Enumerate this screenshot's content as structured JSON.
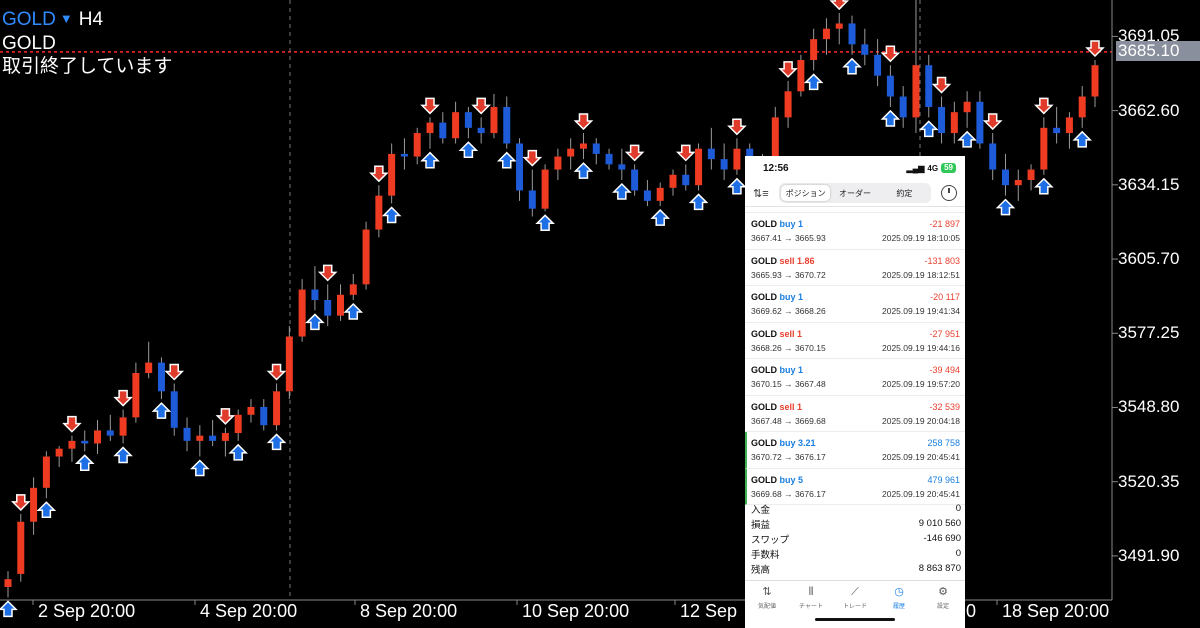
{
  "header": {
    "symbol": "GOLD",
    "caret": "▼",
    "timeframe": "H4",
    "symbol_name": "GOLD",
    "status": "取引終了しています"
  },
  "price_axis": {
    "labels": [
      "3691.05",
      "3662.60",
      "3634.15",
      "3605.70",
      "3577.25",
      "3548.80",
      "3520.35",
      "3491.90"
    ],
    "current": "3685.10"
  },
  "time_axis": {
    "labels": [
      "2 Sep 20:00",
      "4 Sep 20:00",
      "8 Sep 20:00",
      "10 Sep 20:00",
      "12 Sep",
      "18 Sep 20:00"
    ],
    "hidden_fragment": "0"
  },
  "colors": {
    "bull": "#ee3b22",
    "bear": "#1e5bd8",
    "grid": "#2e2e2e",
    "current_line": "#ff2a2a",
    "buy_arrow": "#1e6fe6",
    "sell_arrow": "#e03a2a"
  },
  "chart_data": {
    "type": "candlestick",
    "ylim": [
      3475,
      3705
    ],
    "current_price": 3685.1,
    "ohlc": [
      [
        3480,
        3486,
        3476,
        3483
      ],
      [
        3485,
        3508,
        3482,
        3505
      ],
      [
        3505,
        3522,
        3500,
        3518
      ],
      [
        3518,
        3532,
        3514,
        3530
      ],
      [
        3530,
        3534,
        3526,
        3533
      ],
      [
        3533,
        3538,
        3528,
        3536
      ],
      [
        3536,
        3540,
        3532,
        3535
      ],
      [
        3535,
        3544,
        3531,
        3540
      ],
      [
        3540,
        3546,
        3536,
        3538
      ],
      [
        3538,
        3548,
        3535,
        3545
      ],
      [
        3545,
        3566,
        3543,
        3562
      ],
      [
        3562,
        3574,
        3560,
        3566
      ],
      [
        3566,
        3568,
        3552,
        3555
      ],
      [
        3555,
        3558,
        3538,
        3541
      ],
      [
        3541,
        3545,
        3532,
        3536
      ],
      [
        3536,
        3542,
        3530,
        3538
      ],
      [
        3538,
        3544,
        3534,
        3536
      ],
      [
        3536,
        3541,
        3530,
        3539
      ],
      [
        3539,
        3548,
        3536,
        3546
      ],
      [
        3546,
        3552,
        3543,
        3549
      ],
      [
        3549,
        3552,
        3540,
        3542
      ],
      [
        3542,
        3558,
        3540,
        3555
      ],
      [
        3555,
        3580,
        3552,
        3576
      ],
      [
        3576,
        3598,
        3574,
        3594
      ],
      [
        3594,
        3603,
        3586,
        3590
      ],
      [
        3590,
        3596,
        3580,
        3584
      ],
      [
        3584,
        3596,
        3582,
        3592
      ],
      [
        3592,
        3600,
        3590,
        3596
      ],
      [
        3596,
        3620,
        3594,
        3617
      ],
      [
        3617,
        3634,
        3614,
        3630
      ],
      [
        3630,
        3650,
        3627,
        3646
      ],
      [
        3646,
        3652,
        3640,
        3645
      ],
      [
        3645,
        3656,
        3642,
        3654
      ],
      [
        3654,
        3660,
        3648,
        3658
      ],
      [
        3658,
        3662,
        3650,
        3652
      ],
      [
        3652,
        3666,
        3650,
        3662
      ],
      [
        3662,
        3664,
        3652,
        3656
      ],
      [
        3656,
        3660,
        3650,
        3654
      ],
      [
        3654,
        3669,
        3652,
        3664
      ],
      [
        3664,
        3668,
        3648,
        3650
      ],
      [
        3650,
        3652,
        3628,
        3632
      ],
      [
        3632,
        3640,
        3622,
        3625
      ],
      [
        3625,
        3642,
        3624,
        3640
      ],
      [
        3640,
        3648,
        3636,
        3645
      ],
      [
        3645,
        3652,
        3640,
        3648
      ],
      [
        3648,
        3654,
        3644,
        3650
      ],
      [
        3650,
        3652,
        3642,
        3646
      ],
      [
        3646,
        3648,
        3640,
        3642
      ],
      [
        3642,
        3648,
        3636,
        3640
      ],
      [
        3640,
        3642,
        3630,
        3632
      ],
      [
        3632,
        3636,
        3626,
        3628
      ],
      [
        3628,
        3635,
        3626,
        3633
      ],
      [
        3633,
        3640,
        3630,
        3638
      ],
      [
        3638,
        3642,
        3632,
        3634
      ],
      [
        3634,
        3650,
        3632,
        3648
      ],
      [
        3648,
        3656,
        3640,
        3644
      ],
      [
        3644,
        3650,
        3636,
        3640
      ],
      [
        3640,
        3652,
        3638,
        3648
      ],
      [
        3648,
        3650,
        3634,
        3636
      ],
      [
        3636,
        3646,
        3632,
        3644
      ],
      [
        3644,
        3664,
        3640,
        3660
      ],
      [
        3660,
        3674,
        3656,
        3670
      ],
      [
        3670,
        3684,
        3668,
        3682
      ],
      [
        3682,
        3694,
        3678,
        3690
      ],
      [
        3690,
        3698,
        3684,
        3694
      ],
      [
        3694,
        3700,
        3688,
        3696
      ],
      [
        3696,
        3699,
        3684,
        3688
      ],
      [
        3688,
        3694,
        3680,
        3684
      ],
      [
        3684,
        3690,
        3672,
        3676
      ],
      [
        3676,
        3680,
        3664,
        3668
      ],
      [
        3668,
        3672,
        3656,
        3660
      ],
      [
        3660,
        3706,
        3654,
        3680
      ],
      [
        3680,
        3684,
        3660,
        3664
      ],
      [
        3664,
        3668,
        3650,
        3654
      ],
      [
        3654,
        3666,
        3650,
        3662
      ],
      [
        3662,
        3670,
        3656,
        3666
      ],
      [
        3666,
        3670,
        3648,
        3650
      ],
      [
        3650,
        3654,
        3636,
        3640
      ],
      [
        3640,
        3646,
        3630,
        3634
      ],
      [
        3634,
        3640,
        3628,
        3636
      ],
      [
        3636,
        3642,
        3632,
        3640
      ],
      [
        3640,
        3660,
        3638,
        3656
      ],
      [
        3656,
        3664,
        3650,
        3654
      ],
      [
        3654,
        3662,
        3648,
        3660
      ],
      [
        3660,
        3672,
        3656,
        3668
      ],
      [
        3668,
        3682,
        3664,
        3680
      ]
    ]
  },
  "phone": {
    "status_time": "12:56",
    "network": "4G",
    "battery": "59",
    "tabs": [
      {
        "label": "ポジション",
        "active": true
      },
      {
        "label": "オーダー",
        "active": false
      },
      {
        "label": "約定",
        "active": false
      }
    ],
    "trades": [
      {
        "symbol": "GOLD",
        "side": "buy",
        "type": "buy 1",
        "profit": "-21 897",
        "prices": "3667.41 → 3665.93",
        "time": "2025.09.19 18:10:05",
        "pos": false
      },
      {
        "symbol": "GOLD",
        "side": "sell",
        "type": "sell 1.86",
        "profit": "-131 803",
        "prices": "3665.93 → 3670.72",
        "time": "2025.09.19 18:12:51",
        "pos": false
      },
      {
        "symbol": "GOLD",
        "side": "buy",
        "type": "buy 1",
        "profit": "-20 117",
        "prices": "3669.62 → 3668.26",
        "time": "2025.09.19 19:41:34",
        "pos": false
      },
      {
        "symbol": "GOLD",
        "side": "sell",
        "type": "sell 1",
        "profit": "-27 951",
        "prices": "3668.26 → 3670.15",
        "time": "2025.09.19 19:44:16",
        "pos": false
      },
      {
        "symbol": "GOLD",
        "side": "buy",
        "type": "buy 1",
        "profit": "-39 494",
        "prices": "3670.15 → 3667.48",
        "time": "2025.09.19 19:57:20",
        "pos": false
      },
      {
        "symbol": "GOLD",
        "side": "sell",
        "type": "sell 1",
        "profit": "-32 539",
        "prices": "3667.48 → 3669.68",
        "time": "2025.09.19 20:04:18",
        "pos": false
      },
      {
        "symbol": "GOLD",
        "side": "buy",
        "type": "buy 3.21",
        "profit": "258 758",
        "prices": "3670.72 → 3676.17",
        "time": "2025.09.19 20:45:41",
        "pos": true
      },
      {
        "symbol": "GOLD",
        "side": "buy",
        "type": "buy 5",
        "profit": "479 961",
        "prices": "3669.68 → 3676.17",
        "time": "2025.09.19 20:45:41",
        "pos": true
      }
    ],
    "summary": [
      {
        "label": "入金",
        "value": "0"
      },
      {
        "label": "損益",
        "value": "9 010 560"
      },
      {
        "label": "スワップ",
        "value": "-146 690"
      },
      {
        "label": "手数料",
        "value": "0"
      },
      {
        "label": "残高",
        "value": "8 863 870"
      }
    ],
    "nav": [
      {
        "label": "気配値",
        "icon": "quotes-icon",
        "glyph": "⇅",
        "active": false
      },
      {
        "label": "チャート",
        "icon": "chart-icon",
        "glyph": "⫴",
        "active": false
      },
      {
        "label": "トレード",
        "icon": "trade-icon",
        "glyph": "⟋",
        "active": false
      },
      {
        "label": "履歴",
        "icon": "history-icon",
        "glyph": "◷",
        "active": true
      },
      {
        "label": "設定",
        "icon": "settings-icon",
        "glyph": "⚙",
        "active": false
      }
    ]
  }
}
